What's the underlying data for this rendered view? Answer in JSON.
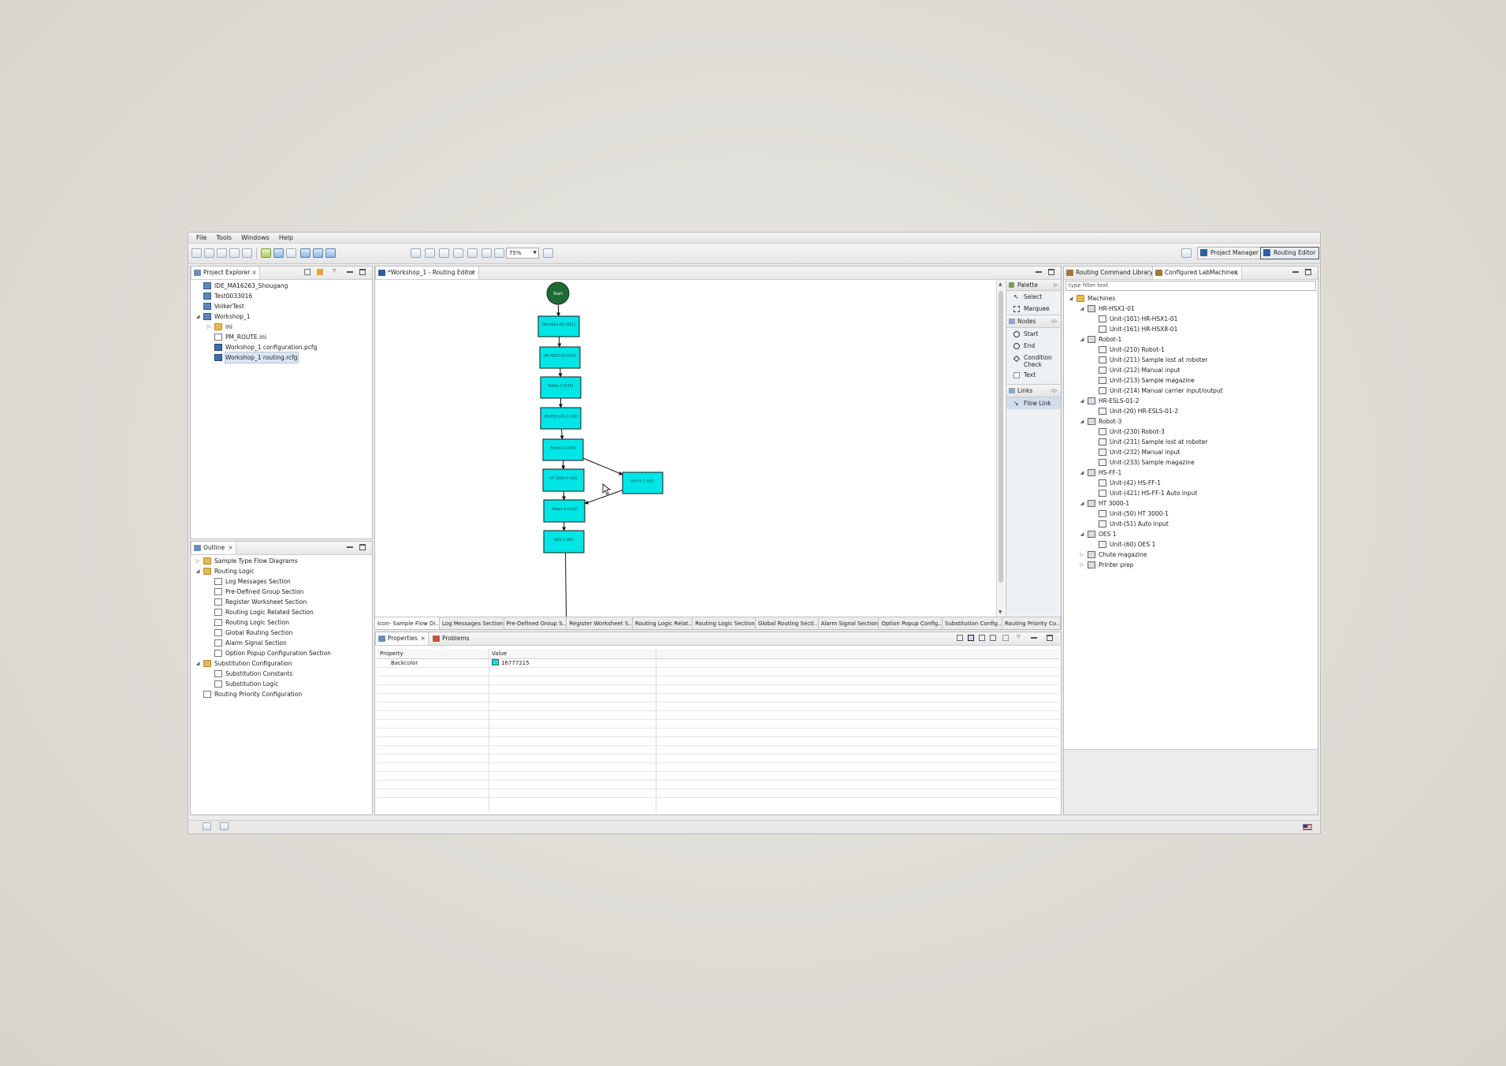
{
  "menu": [
    "File",
    "Tools",
    "Windows",
    "Help"
  ],
  "toolbar": {
    "zoom": "75%",
    "perspectives": [
      {
        "label": "Project Manager",
        "active": false
      },
      {
        "label": "Routing Editor",
        "active": true
      }
    ]
  },
  "project_explorer": {
    "title": "Project Explorer",
    "items": [
      {
        "label": "IDE_MA16263_Shougang",
        "icon": "project-icon",
        "indent": 0,
        "arrow": ""
      },
      {
        "label": "Test0033016",
        "icon": "project-icon",
        "indent": 0,
        "arrow": ""
      },
      {
        "label": "VolkerTest",
        "icon": "project-icon",
        "indent": 0,
        "arrow": ""
      },
      {
        "label": "Workshop_1",
        "icon": "project-icon",
        "indent": 0,
        "arrow": "◢"
      },
      {
        "label": "ini",
        "icon": "folder-icon",
        "indent": 1,
        "arrow": "▷"
      },
      {
        "label": "PM_ROUTE.ini",
        "icon": "file-icon",
        "indent": 1,
        "arrow": ""
      },
      {
        "label": "Workshop_1 configuration.pcfg",
        "icon": "config-file-icon",
        "indent": 1,
        "arrow": ""
      },
      {
        "label": "Workshop_1 routing.rcfg",
        "icon": "routing-file-icon",
        "indent": 1,
        "arrow": "",
        "selected": true
      }
    ]
  },
  "outline": {
    "title": "Outline",
    "items": [
      {
        "label": "Sample Type Flow Diagrams",
        "icon": "folder-icon",
        "indent": 0,
        "arrow": "▷"
      },
      {
        "label": "Routing Logic",
        "icon": "folder-icon",
        "indent": 0,
        "arrow": "◢"
      },
      {
        "label": "Log Messages Section",
        "icon": "file-icon",
        "indent": 1,
        "arrow": ""
      },
      {
        "label": "Pre-Defined Group Section",
        "icon": "file-icon",
        "indent": 1,
        "arrow": ""
      },
      {
        "label": "Register Worksheet Section",
        "icon": "file-icon",
        "indent": 1,
        "arrow": ""
      },
      {
        "label": "Routing Logic Related Section",
        "icon": "file-icon",
        "indent": 1,
        "arrow": ""
      },
      {
        "label": "Routing Logic Section",
        "icon": "file-icon",
        "indent": 1,
        "arrow": ""
      },
      {
        "label": "Global Routing Section",
        "icon": "file-icon",
        "indent": 1,
        "arrow": ""
      },
      {
        "label": "Alarm Signal Section",
        "icon": "file-icon",
        "indent": 1,
        "arrow": ""
      },
      {
        "label": "Option Popup Configuration Section",
        "icon": "file-icon",
        "indent": 1,
        "arrow": ""
      },
      {
        "label": "Substitution Configuration",
        "icon": "folder-icon",
        "indent": 0,
        "arrow": "◢"
      },
      {
        "label": "Substitution Constants",
        "icon": "file-icon",
        "indent": 1,
        "arrow": ""
      },
      {
        "label": "Substitution Logic",
        "icon": "file-icon",
        "indent": 1,
        "arrow": ""
      },
      {
        "label": "Routing Priority Configuration",
        "icon": "file-icon",
        "indent": 0,
        "arrow": ""
      }
    ]
  },
  "editor": {
    "title": "*Workshop_1 - Routing Editor",
    "start_label": "Start",
    "nodes": [
      {
        "id": "n1",
        "label": "HR-HSX1-01-(101)"
      },
      {
        "id": "n2",
        "label": "HR-HSX1-01-(161)"
      },
      {
        "id": "n3",
        "label": "Robot-1-(210)"
      },
      {
        "id": "n4",
        "label": "HR-ESLS-01-2-(20)"
      },
      {
        "id": "n5",
        "label": "Robot-3-(230)"
      },
      {
        "id": "n6",
        "label": "HT 3000-1-(50)"
      },
      {
        "id": "n7",
        "label": "HS-FF-1-(42)"
      },
      {
        "id": "n8",
        "label": "Robot-3-(230)"
      },
      {
        "id": "n9",
        "label": "OES 1-(60)"
      }
    ],
    "node_color": "#00e5e5",
    "start_color": "#1e6b34",
    "page_tabs": [
      "Icon- Sample Flow Di..",
      "Log Messages Section",
      "Pre-Defined Group S..",
      "Register Worksheet S..",
      "Routing Logic Relat..",
      "Routing Logic Section",
      "Global Routing Secti..",
      "Alarm Signal Section",
      "Option Popup Config..",
      "Substitution Config..",
      "Routing Priority Co.."
    ]
  },
  "palette": {
    "title": "Palette",
    "tools": [
      "Select",
      "Marquee"
    ],
    "nodes_drawer": "Nodes",
    "nodes": [
      "Start",
      "End",
      "Condition Check",
      "Text"
    ],
    "links_drawer": "Links",
    "links": [
      "Flow Link"
    ]
  },
  "properties": {
    "tabs": [
      "Properties",
      "Problems"
    ],
    "columns": [
      "Property",
      "Value"
    ],
    "rows": [
      {
        "property": "Backcolor",
        "value": "16777215"
      }
    ]
  },
  "right_panel": {
    "tabs": [
      "Routing Command Library",
      "Configured LabMachines"
    ],
    "filter_placeholder": "type filter text",
    "items": [
      {
        "label": "Machines",
        "icon": "folder-icon",
        "indent": 0,
        "arrow": "◢"
      },
      {
        "label": "HR-HSX1-01",
        "icon": "machine-icon",
        "indent": 1,
        "arrow": "◢"
      },
      {
        "label": "Unit-(101) HR-HSX1-01",
        "icon": "unit-icon",
        "indent": 2,
        "arrow": ""
      },
      {
        "label": "Unit-(161) HR-HSX8-01",
        "icon": "unit-icon",
        "indent": 2,
        "arrow": ""
      },
      {
        "label": "Robot-1",
        "icon": "machine-icon",
        "indent": 1,
        "arrow": "◢"
      },
      {
        "label": "Unit-(210) Robot-1",
        "icon": "unit-icon",
        "indent": 2,
        "arrow": ""
      },
      {
        "label": "Unit-(211) Sample lost at roboter",
        "icon": "unit-icon",
        "indent": 2,
        "arrow": ""
      },
      {
        "label": "Unit-(212) Manual input",
        "icon": "unit-icon",
        "indent": 2,
        "arrow": ""
      },
      {
        "label": "Unit-(213) Sample magazine",
        "icon": "unit-icon",
        "indent": 2,
        "arrow": ""
      },
      {
        "label": "Unit-(214) Manual carrier input/output",
        "icon": "unit-icon",
        "indent": 2,
        "arrow": ""
      },
      {
        "label": "HR-ESLS-01-2",
        "icon": "machine-icon",
        "indent": 1,
        "arrow": "◢"
      },
      {
        "label": "Unit-(20) HR-ESLS-01-2",
        "icon": "unit-icon",
        "indent": 2,
        "arrow": ""
      },
      {
        "label": "Robot-3",
        "icon": "machine-icon",
        "indent": 1,
        "arrow": "◢"
      },
      {
        "label": "Unit-(230) Robot-3",
        "icon": "unit-icon",
        "indent": 2,
        "arrow": ""
      },
      {
        "label": "Unit-(231) Sample lost at roboter",
        "icon": "unit-icon",
        "indent": 2,
        "arrow": ""
      },
      {
        "label": "Unit-(232) Manual input",
        "icon": "unit-icon",
        "indent": 2,
        "arrow": ""
      },
      {
        "label": "Unit-(233) Sample magazine",
        "icon": "unit-icon",
        "indent": 2,
        "arrow": ""
      },
      {
        "label": "HS-FF-1",
        "icon": "machine-icon",
        "indent": 1,
        "arrow": "◢"
      },
      {
        "label": "Unit-(42) HS-FF-1",
        "icon": "unit-icon",
        "indent": 2,
        "arrow": ""
      },
      {
        "label": "Unit-(421) HS-FF-1 Auto input",
        "icon": "unit-icon",
        "indent": 2,
        "arrow": ""
      },
      {
        "label": "HT 3000-1",
        "icon": "machine-icon",
        "indent": 1,
        "arrow": "◢"
      },
      {
        "label": "Unit-(50) HT 3000-1",
        "icon": "unit-icon",
        "indent": 2,
        "arrow": ""
      },
      {
        "label": "Unit-(51) Auto input",
        "icon": "unit-icon",
        "indent": 2,
        "arrow": ""
      },
      {
        "label": "OES 1",
        "icon": "machine-icon",
        "indent": 1,
        "arrow": "◢"
      },
      {
        "label": "Unit-(60) OES 1",
        "icon": "unit-icon",
        "indent": 2,
        "arrow": ""
      },
      {
        "label": "Chute magazine",
        "icon": "machine-icon",
        "indent": 1,
        "arrow": "▷"
      },
      {
        "label": "Printer prep",
        "icon": "machine-icon",
        "indent": 1,
        "arrow": "▷"
      }
    ]
  }
}
